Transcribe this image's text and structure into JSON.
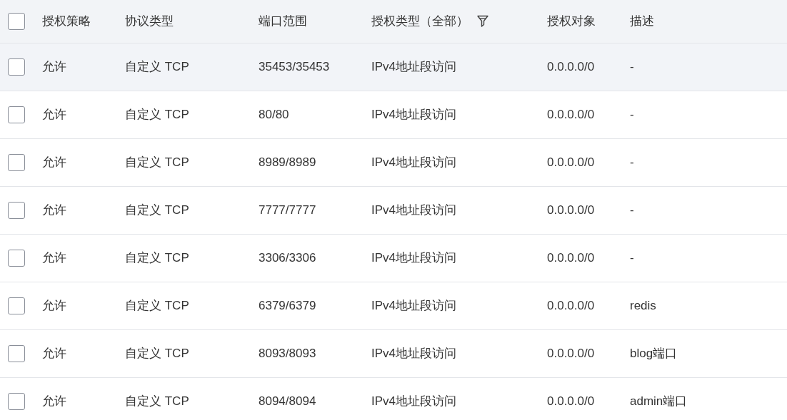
{
  "header": {
    "checked": false,
    "columns": [
      "授权策略",
      "协议类型",
      "端口范围",
      "授权类型（全部）",
      "授权对象",
      "描述"
    ]
  },
  "rows": [
    {
      "checked": false,
      "hovered": true,
      "cells": [
        "允许",
        "自定义 TCP",
        "35453/35453",
        "IPv4地址段访问",
        "0.0.0.0/0",
        "-"
      ]
    },
    {
      "checked": false,
      "hovered": false,
      "cells": [
        "允许",
        "自定义 TCP",
        "80/80",
        "IPv4地址段访问",
        "0.0.0.0/0",
        "-"
      ]
    },
    {
      "checked": false,
      "hovered": false,
      "cells": [
        "允许",
        "自定义 TCP",
        "8989/8989",
        "IPv4地址段访问",
        "0.0.0.0/0",
        "-"
      ]
    },
    {
      "checked": false,
      "hovered": false,
      "cells": [
        "允许",
        "自定义 TCP",
        "7777/7777",
        "IPv4地址段访问",
        "0.0.0.0/0",
        "-"
      ]
    },
    {
      "checked": false,
      "hovered": false,
      "cells": [
        "允许",
        "自定义 TCP",
        "3306/3306",
        "IPv4地址段访问",
        "0.0.0.0/0",
        "-"
      ]
    },
    {
      "checked": false,
      "hovered": false,
      "cells": [
        "允许",
        "自定义 TCP",
        "6379/6379",
        "IPv4地址段访问",
        "0.0.0.0/0",
        "redis"
      ]
    },
    {
      "checked": false,
      "hovered": false,
      "cells": [
        "允许",
        "自定义 TCP",
        "8093/8093",
        "IPv4地址段访问",
        "0.0.0.0/0",
        "blog端口"
      ]
    },
    {
      "checked": false,
      "hovered": false,
      "cells": [
        "允许",
        "自定义 TCP",
        "8094/8094",
        "IPv4地址段访问",
        "0.0.0.0/0",
        "admin端口"
      ]
    }
  ]
}
